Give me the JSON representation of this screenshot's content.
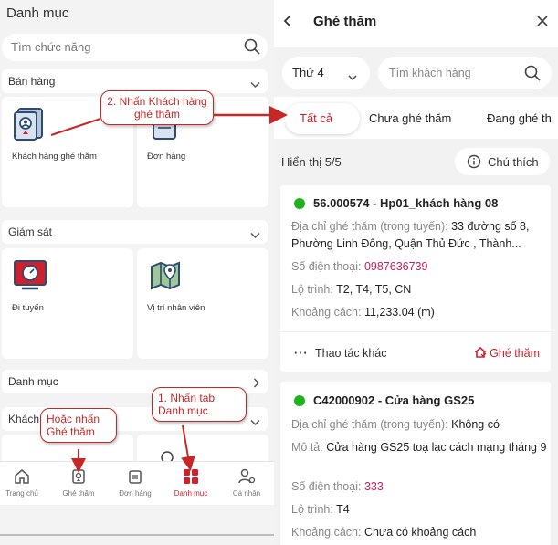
{
  "left": {
    "title": "Danh mục",
    "search_placeholder": "Tìm chức năng",
    "sections": {
      "sales": {
        "label": "Bán hàng",
        "tiles": [
          {
            "label": "Khách hàng ghé thăm"
          },
          {
            "label": "Đơn hàng"
          }
        ]
      },
      "monitor": {
        "label": "Giám sát",
        "tiles": [
          {
            "label": "Đi tuyến"
          },
          {
            "label": "Vị trí nhân viên"
          }
        ]
      },
      "catalog": {
        "label": "Danh mục"
      },
      "customer": {
        "label": "Khách"
      }
    },
    "bottom_nav": [
      {
        "label": "Trang chủ",
        "icon": "home-icon"
      },
      {
        "label": "Ghé thăm",
        "icon": "visit-icon"
      },
      {
        "label": "Đơn hàng",
        "icon": "order-icon"
      },
      {
        "label": "Danh mục",
        "icon": "grid-icon",
        "active": true
      },
      {
        "label": "Cá nhân",
        "icon": "user-settings-icon"
      }
    ]
  },
  "right": {
    "title": "Ghé thăm",
    "day_select": "Thứ 4",
    "customer_search_placeholder": "Tìm khách hàng",
    "tabs": [
      "Tất cả",
      "Chưa ghé thăm",
      "Đang ghé th"
    ],
    "showing": "Hiển thị 5/5",
    "note_button": "Chú thích",
    "cards": [
      {
        "name": "56.000574 - Hp01_khách hàng 08",
        "address_key": "Địa chỉ ghé thăm (trong tuyến):",
        "address_value": "33 đường số 8, Phường Linh Đông, Quận Thủ Đức , Thành...",
        "phone_key": "Số điện thoại:",
        "phone_value": "0987636739",
        "route_key": "Lộ trình:",
        "route_value": "T2, T4, T5, CN",
        "distance_key": "Khoảng cách:",
        "distance_value": "11,233.04 (m)",
        "more_label": "Thao tác khác",
        "visit_label": "Ghé thăm"
      },
      {
        "name": "C42000902 - Cửa hàng GS25",
        "address_key": "Địa chỉ ghé thăm (trong tuyến):",
        "address_value": "Không có",
        "desc_key": "Mô tả:",
        "desc_value": "Cửa hàng GS25 toạ lạc cách mạng tháng 9",
        "phone_key": "Số điện thoại:",
        "phone_value": "333",
        "route_key": "Lộ trình:",
        "route_value": "T4",
        "distance_key": "Khoảng cách:",
        "distance_value": "Chưa có khoảng cách"
      }
    ]
  },
  "annotations": {
    "step2": "2. Nhấn Khách hàng ghé thăm",
    "step1": "1. Nhấn tab Danh mục",
    "alt": "Hoặc nhấn Ghé thăm"
  },
  "colors": {
    "accent": "#d0202c",
    "online": "#1db31d",
    "annotation": "#c62828"
  }
}
